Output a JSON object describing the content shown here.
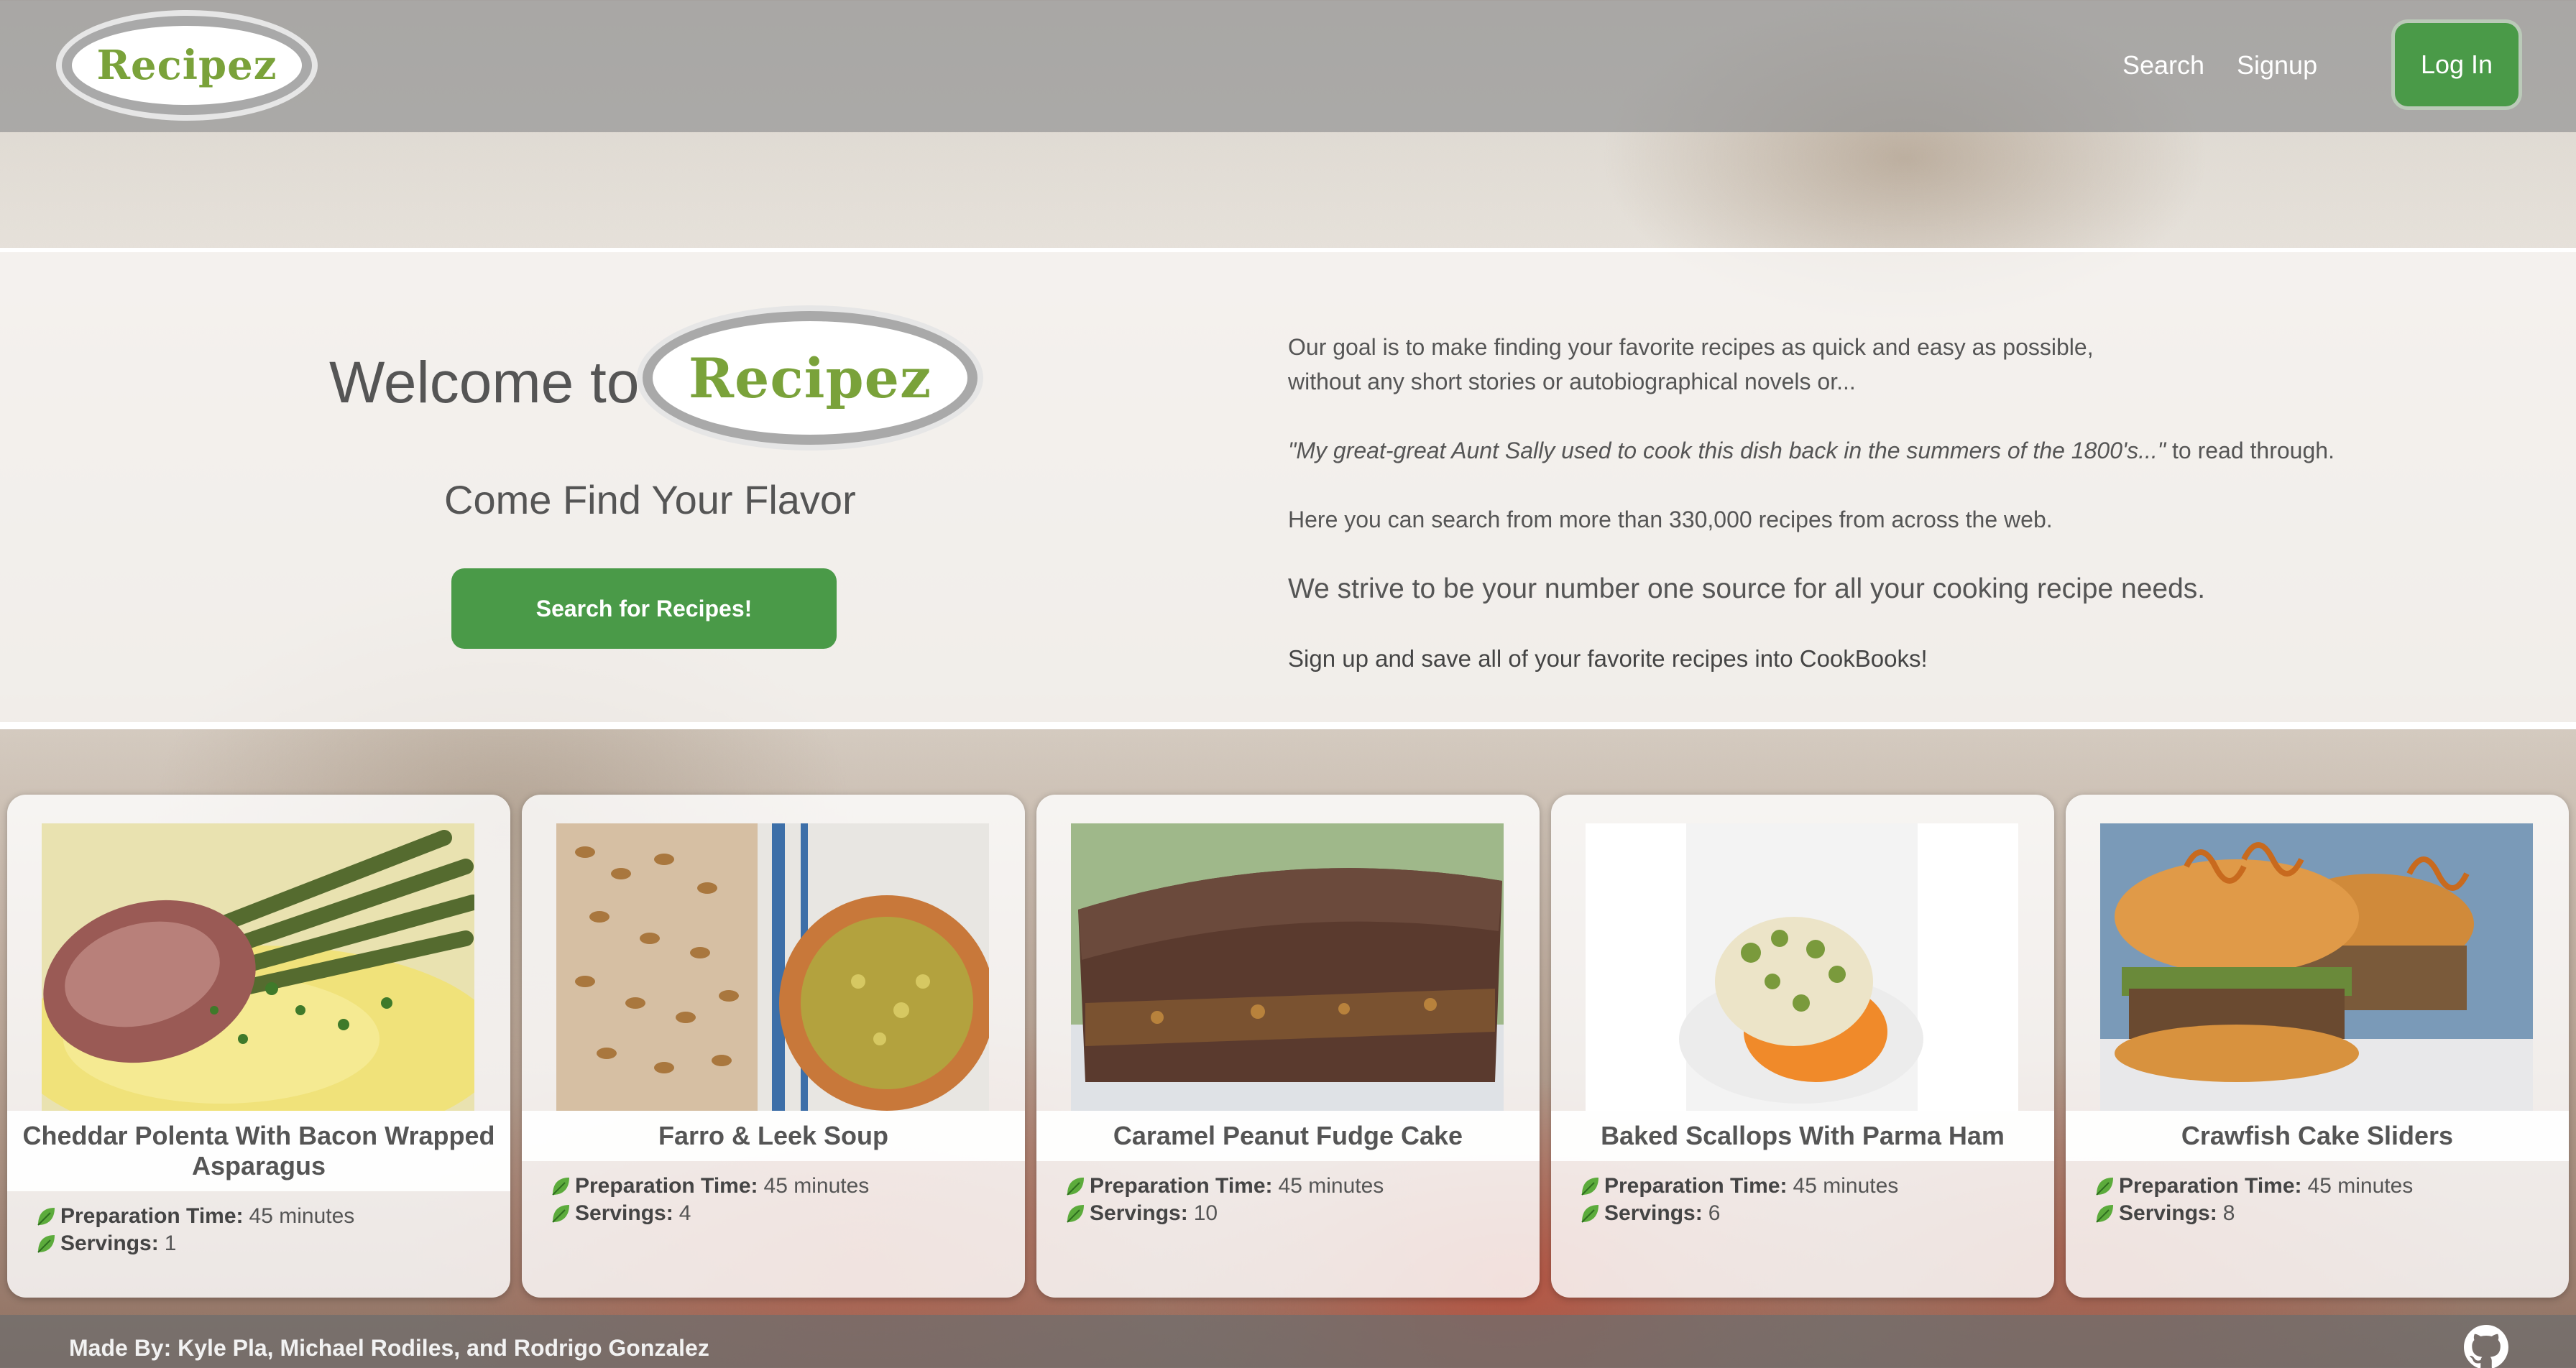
{
  "nav": {
    "logo_text": "Recipez",
    "links": [
      "Search",
      "Signup"
    ],
    "login_label": "Log In"
  },
  "hero": {
    "welcome_text": "Welcome to",
    "logo_text": "Recipez",
    "tagline": "Come Find Your Flavor",
    "cta_label": "Search for Recipes!",
    "about": {
      "p1_line1": "Our goal is to make finding your favorite recipes as quick and easy as possible,",
      "p1_line2": "without any short stories or autobiographical novels or...",
      "quote": "\"My great-great Aunt Sally used to cook this dish back in the summers of the 1800's...\"",
      "quote_suffix": " to read through.",
      "p_count": "Here you can search from more than 330,000 recipes from across the web.",
      "p_strive": "We strive to be your number one source for all your cooking recipe needs.",
      "p_signup": "Sign up and save all of your favorite recipes into CookBooks!"
    }
  },
  "meta_labels": {
    "prep": "Preparation Time:",
    "servings": "Servings:"
  },
  "recipes": [
    {
      "title": "Cheddar Polenta With Bacon Wrapped Asparagus",
      "prep_time": "45 minutes",
      "servings": "1",
      "image_icon": "polenta-asparagus-photo"
    },
    {
      "title": "Farro & Leek Soup",
      "prep_time": "45 minutes",
      "servings": "4",
      "image_icon": "farro-soup-photo"
    },
    {
      "title": "Caramel Peanut Fudge Cake",
      "prep_time": "45 minutes",
      "servings": "10",
      "image_icon": "fudge-cake-photo"
    },
    {
      "title": "Baked Scallops With Parma Ham",
      "prep_time": "45 minutes",
      "servings": "6",
      "image_icon": "scallops-photo"
    },
    {
      "title": "Crawfish Cake Sliders",
      "prep_time": "45 minutes",
      "servings": "8",
      "image_icon": "sliders-photo"
    }
  ],
  "footer": {
    "credits": "Made By: Kyle Pla, Michael Rodiles, and Rodrigo Gonzalez",
    "icon": "github-icon"
  },
  "colors": {
    "brand_green": "#4a9a48",
    "logo_green": "#7aa23a",
    "text_gray": "#555555"
  }
}
